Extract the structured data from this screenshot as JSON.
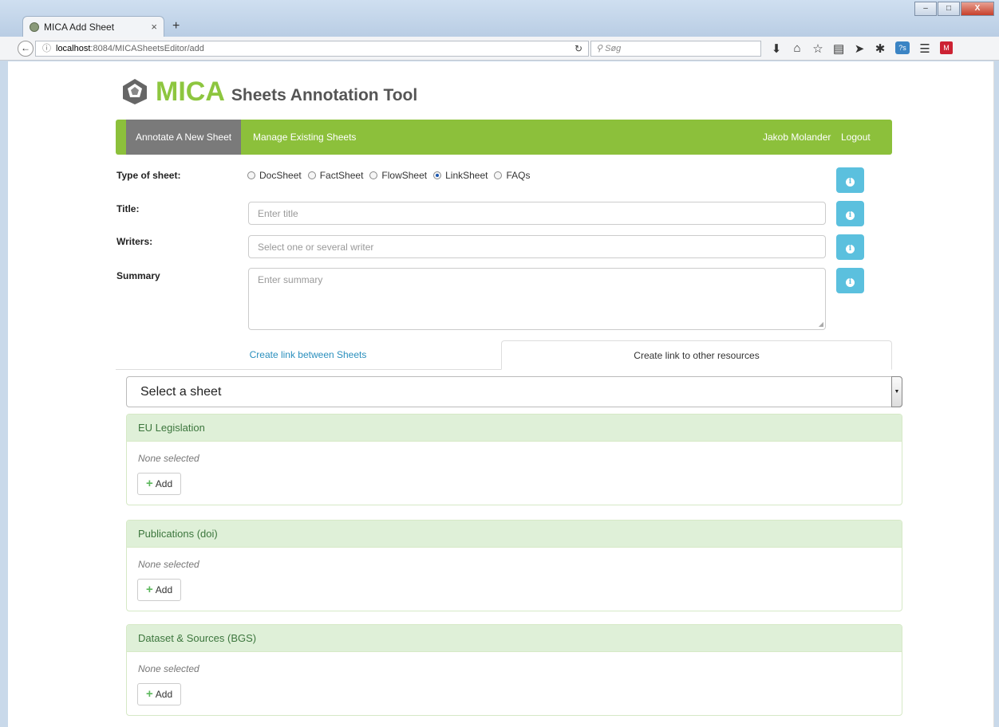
{
  "browser": {
    "tab_title": "MICA Add Sheet",
    "tab_close": "×",
    "new_tab": "+",
    "url_host": "localhost",
    "url_path": ":8084/MICASheetsEditor/add",
    "search_placeholder": "Søg",
    "window_controls": [
      "–",
      "□",
      "X"
    ]
  },
  "app": {
    "logo_main": "MICA",
    "logo_sub": "Sheets Annotation Tool",
    "accent_color": "#8cc03b"
  },
  "nav": {
    "annotate": "Annotate A New Sheet",
    "manage": "Manage Existing Sheets",
    "user": "Jakob Molander",
    "logout": "Logout"
  },
  "form": {
    "type_label": "Type of sheet:",
    "types": [
      {
        "label": "DocSheet",
        "selected": false
      },
      {
        "label": "FactSheet",
        "selected": false
      },
      {
        "label": "FlowSheet",
        "selected": false
      },
      {
        "label": "LinkSheet",
        "selected": true
      },
      {
        "label": "FAQs",
        "selected": false
      }
    ],
    "title_label": "Title:",
    "title_placeholder": "Enter title",
    "writers_label": "Writers:",
    "writers_placeholder": "Select one or several writer",
    "summary_label": "Summary",
    "summary_placeholder": "Enter summary"
  },
  "link_tabs": {
    "between": "Create link between Sheets",
    "other": "Create link to other resources"
  },
  "sheet_select": {
    "value": "Select a sheet"
  },
  "panels": [
    {
      "title": "EU Legislation",
      "status": "None selected",
      "add_label": "Add"
    },
    {
      "title": "Publications (doi)",
      "status": "None selected",
      "add_label": "Add"
    },
    {
      "title": "Dataset & Sources (BGS)",
      "status": "None selected",
      "add_label": "Add"
    }
  ]
}
